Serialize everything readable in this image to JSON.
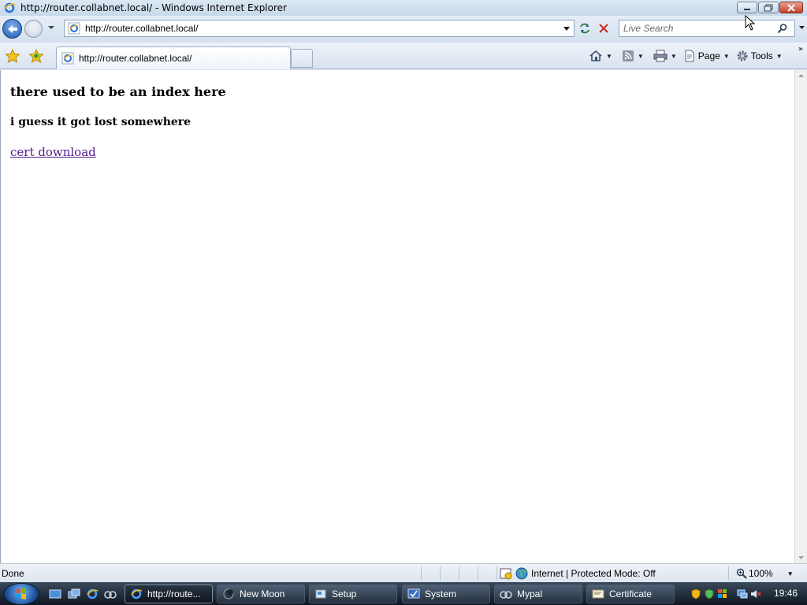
{
  "window": {
    "title": "http://router.collabnet.local/ - Windows Internet Explorer"
  },
  "address": {
    "url": "http://router.collabnet.local/"
  },
  "search": {
    "placeholder": "Live Search"
  },
  "tab": {
    "label": "http://router.collabnet.local/"
  },
  "toolbar": {
    "page_label": "Page",
    "tools_label": "Tools"
  },
  "page": {
    "heading": "there used to be an index here",
    "subheading": "i guess it got lost somewhere",
    "link": "cert download"
  },
  "status": {
    "text": "Done",
    "zone": "Internet | Protected Mode: Off",
    "zoom": "100%"
  },
  "taskbar": {
    "items": [
      {
        "label": "http://route..."
      },
      {
        "label": "New Moon"
      },
      {
        "label": "Setup"
      },
      {
        "label": "System"
      },
      {
        "label": "Mypal"
      },
      {
        "label": "Certificate"
      }
    ],
    "clock": "19:46"
  },
  "colors": {
    "link_visited": "#551a8b",
    "accent": "#1d58b3"
  }
}
